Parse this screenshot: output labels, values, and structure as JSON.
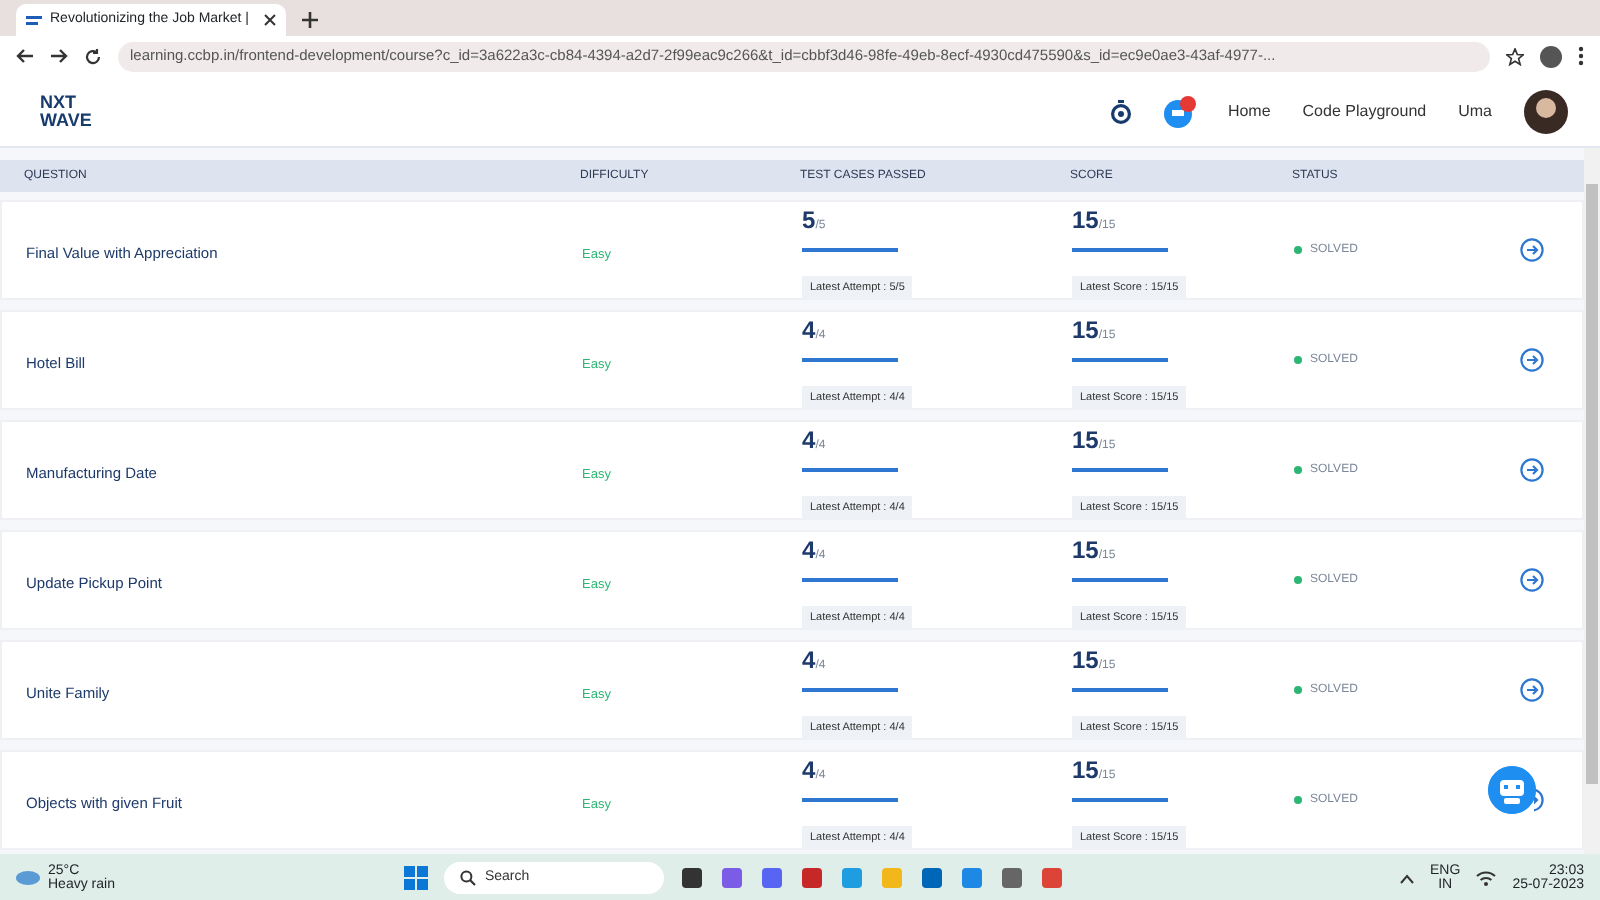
{
  "browser": {
    "tab_title": "Revolutionizing the Job Market |",
    "url": "learning.ccbp.in/frontend-development/course?c_id=3a622a3c-cb84-4394-a2d7-2f99eac9c266&t_id=cbbf3d46-98fe-49eb-8ecf-4930cd475590&s_id=ec9e0ae3-43af-4977-..."
  },
  "header": {
    "logo_top": "NXT",
    "logo_bottom": "WAVE",
    "nav": [
      "Home",
      "Code Playground"
    ],
    "user": "Uma"
  },
  "table": {
    "columns": [
      "QUESTION",
      "DIFFICULTY",
      "TEST CASES PASSED",
      "SCORE",
      "STATUS"
    ],
    "rows": [
      {
        "question": "Final Value with Appreciation",
        "difficulty": "Easy",
        "passed": "5",
        "total": "/5",
        "tests_bar": {
          "level": 1
        },
        "attempt": "Latest Attempt : 5/5",
        "score_bar": {
          "level": 1
        },
        "score": "15",
        "max": "/15",
        "latest": "Latest Score : 15/15",
        "status": "SOLVED",
        "color": "#2bb673"
      },
      {
        "question": "Hotel Bill",
        "difficulty": "Easy",
        "passed": "4",
        "total": "/4",
        "tests_bar": {
          "level": 1
        },
        "attempt": "Latest Attempt : 4/4",
        "score_bar": {
          "level": 1
        },
        "score": "15",
        "max": "/15",
        "latest": "Latest Score : 15/15",
        "status": "SOLVED",
        "color": "#2bb673"
      },
      {
        "question": "Manufacturing Date",
        "difficulty": "Easy",
        "passed": "4",
        "total": "/4",
        "tests_bar": {
          "level": 1
        },
        "attempt": "Latest Attempt : 4/4",
        "score_bar": {
          "level": 1
        },
        "score": "15",
        "max": "/15",
        "latest": "Latest Score : 15/15",
        "status": "SOLVED",
        "color": "#2bb673"
      },
      {
        "question": "Update Pickup Point",
        "difficulty": "Easy",
        "passed": "4",
        "total": "/4",
        "tests_bar": {
          "level": 1
        },
        "attempt": "Latest Attempt : 4/4",
        "score_bar": {
          "level": 1
        },
        "score": "15",
        "max": "/15",
        "latest": "Latest Score : 15/15",
        "status": "SOLVED",
        "color": "#2bb673"
      },
      {
        "question": "Unite Family",
        "difficulty": "Easy",
        "passed": "4",
        "total": "/4",
        "tests_bar": {
          "level": 1
        },
        "attempt": "Latest Attempt : 4/4",
        "score_bar": {
          "level": 1
        },
        "score": "15",
        "max": "/15",
        "latest": "Latest Score : 15/15",
        "status": "SOLVED",
        "color": "#2bb673"
      },
      {
        "question": "Objects with given Fruit",
        "difficulty": "Easy",
        "passed": "4",
        "total": "/4",
        "tests_bar": {
          "level": 1
        },
        "attempt": "Latest Attempt : 4/4",
        "score_bar": {
          "level": 1
        },
        "score": "15",
        "max": "/15",
        "latest": "Latest Score : 15/15",
        "status": "SOLVED",
        "color": "#2bb673"
      }
    ]
  },
  "taskbar": {
    "temperature": "25°C",
    "weather": "Heavy rain",
    "search_placeholder": "Search",
    "language": "ENG",
    "region": "IN",
    "time": "23:03",
    "date": "25-07-2023"
  }
}
